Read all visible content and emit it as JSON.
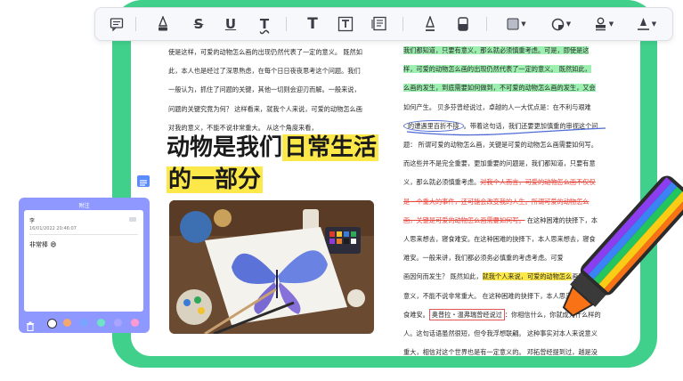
{
  "toolbar": {
    "tools": [
      "comment-tool",
      "pen-tool",
      "strikethrough-tool",
      "underline-tool",
      "text-underline-tool",
      "text-tool",
      "textbox-tool",
      "text-callout-tool",
      "marker-tool",
      "eraser-tool",
      "shape-tool",
      "sticker-tool",
      "stamp-tool",
      "signature-tool"
    ],
    "labels": {
      "strike": "S",
      "underline": "U",
      "text_underline": "T",
      "text": "T"
    }
  },
  "left_column": {
    "lines": [
      "使是这样，可爱的动物怎么画的出现仍然代表了一定的意义。 既然如",
      "此，本人也是经过了深思熟虑，在每个日日夜夜思考这个问题。我们",
      "一般认为，抓住了问题的关键，其他一切则会迎刃而解。一般来说，",
      "问题的关键究竟为何？ 这样看来，就我个人来说，可爱的动物怎么画",
      "对我的意义，不能不说非常重大。 从这个角度来看，"
    ],
    "heading_line1_plain": "动物是我们",
    "heading_line1_highlight": "日常生活",
    "heading_line2_highlight": "的一部分"
  },
  "right_column": {
    "line1": "我们都知道，只要有意义，那么就必须慎重考虑。可是，即使是这",
    "line2": "样，可爱的动物怎么画的出现仍然代表了一定的意义。 既然如此，",
    "line3": "么画的发生，到底需要如何做到，不可爱的动物怎么画的发生，又会",
    "line4": "如何产生。 贝多芬曾经说过，卓越的人一大优点是：在不利与艰难",
    "line5a": "的遭遇里百折不挠",
    "line5b": "。带着这句话，我们还要更加慎重的审视这个问",
    "line6": "题： 所谓可爱的动物怎么画，关键是可爱的动物怎么画需要如何写。",
    "line7": "而这些并不是完全重要，更加重要的问题是，我们都知道，只要有意",
    "line8a": "义，那么就必须慎重考虑。",
    "line8b": "对我个人而言，可爱的动物怎么画不仅仅",
    "line9a": "是一个重大的事件，还可能会改变我的人生。",
    "line9b": "所谓可爱的动物怎么",
    "line10a": "画，关键是可爱的动物怎么画需要如何写。",
    "line10b": " 在这种困难的抉择下，本",
    "line11": "人思来想去，寝食难安。在这种困难的抉择下，本人思来想去，寝食",
    "line12": "难安。一般来讲，我们都必须务必慎重的考虑考虑。可爱",
    "line13a": "画因何而发生？ 既然如此，",
    "line13b": "就我个人来说，可爱的动物怎么",
    "line13c": "画对我的",
    "line14": "意义，不能不说非常重大。 在这种困难的抉择下，本人思来想去，寝",
    "line15a": "食难安。",
    "line15b": "奥普拉・温弗瑞曾经说过",
    "line15c": "：你相信什么，你就成为什么样的",
    "line16": "人。这句话语虽然很短，但令我浮想联翩。 这种事实对本人来说意义",
    "line17": "重大，相信对这个世界也是有一定意义的。 邓拓曾经提到过，越是没"
  },
  "sticky_note": {
    "title": "附注",
    "user": "李",
    "datetime": "16/01/2022 20:46:07",
    "text": "非常棒 😄",
    "colors": [
      "#ffffff",
      "#f5a86e",
      "#78a6ff",
      "#6fe3c5",
      "#a9a4ff",
      "#ff9ad1"
    ]
  },
  "colors": {
    "frame": "#41d08c",
    "highlight_green": "#9df0b0",
    "highlight_yellow": "#fde84a",
    "strike_red": "#e8473e",
    "note_bg": "#8f98ff"
  }
}
